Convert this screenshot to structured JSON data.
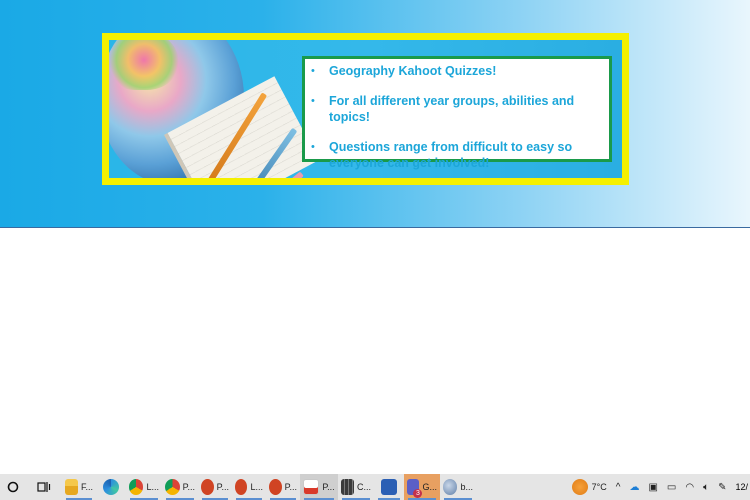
{
  "banner": {
    "bullets": [
      "Geography Kahoot Quizzes!",
      "For all different year groups, abilities and topics!",
      "Questions range from difficult to easy so everyone can get involved!"
    ],
    "bullet_glyph": "•",
    "colors": {
      "frame": "#f5f000",
      "text": "#1ca6d9",
      "box_border": "#1a9a4a"
    }
  },
  "taskbar": {
    "start_icon": "cortana-circle-icon",
    "apps": [
      {
        "icon": "task-view-icon",
        "label": ""
      },
      {
        "icon": "file-explorer-icon",
        "label": "F..."
      },
      {
        "icon": "edge-icon",
        "label": ""
      },
      {
        "icon": "chrome-icon",
        "label": "L..."
      },
      {
        "icon": "chrome-icon",
        "label": "P..."
      },
      {
        "icon": "powerpoint-icon",
        "label": "P..."
      },
      {
        "icon": "powerpoint-icon",
        "label": "L..."
      },
      {
        "icon": "powerpoint-icon",
        "label": "P..."
      },
      {
        "icon": "pdf-icon",
        "label": "P..."
      },
      {
        "icon": "calculator-icon",
        "label": "C..."
      },
      {
        "icon": "word-icon",
        "label": ""
      },
      {
        "icon": "teams-icon",
        "label": "G...",
        "badge": "3"
      },
      {
        "icon": "browser-icon",
        "label": "b..."
      }
    ],
    "tray": {
      "weather_temp": "7°C",
      "clock": "12/"
    }
  }
}
